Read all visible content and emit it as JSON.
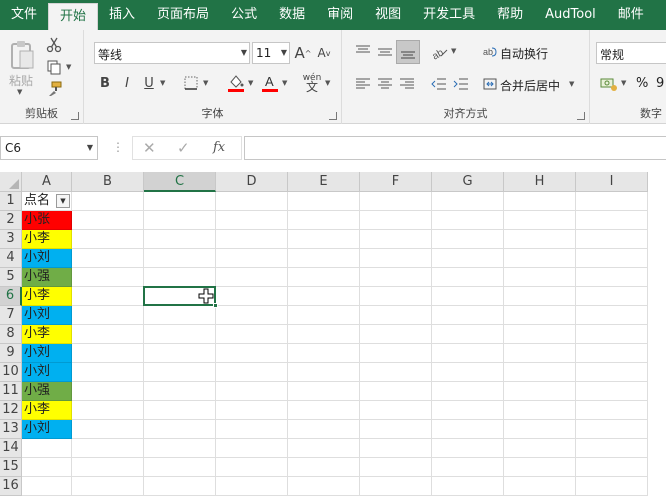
{
  "menu": {
    "tabs": [
      "文件",
      "开始",
      "插入",
      "页面布局",
      "公式",
      "数据",
      "审阅",
      "视图",
      "开发工具",
      "帮助",
      "AudTool",
      "邮件"
    ],
    "active_index": 1
  },
  "ribbon": {
    "clipboard": {
      "label": "剪贴板",
      "paste_label": "粘贴"
    },
    "font": {
      "label": "字体",
      "font_name": "等线",
      "font_size": "11",
      "bold": "B",
      "italic": "I",
      "underline": "U",
      "grow": "A",
      "shrink": "A",
      "phonetic": "wén"
    },
    "alignment": {
      "label": "对齐方式",
      "wrap_text": "自动换行",
      "merge_center": "合并后居中"
    },
    "number": {
      "label": "数字",
      "format": "常规",
      "percent": "%",
      "comma": "9"
    }
  },
  "formula_bar": {
    "name_box": "C6",
    "fx": "fx",
    "formula": ""
  },
  "sheet": {
    "columns": [
      "A",
      "B",
      "C",
      "D",
      "E",
      "F",
      "G",
      "H",
      "I"
    ],
    "rows": [
      "1",
      "2",
      "3",
      "4",
      "5",
      "6",
      "7",
      "8",
      "9",
      "10",
      "11",
      "12",
      "13",
      "14",
      "15",
      "16"
    ],
    "header_cell": "点名",
    "names": [
      "小张",
      "小李",
      "小刘",
      "小强",
      "小李",
      "小刘",
      "小李",
      "小刘",
      "小刘",
      "小强",
      "小李",
      "小刘"
    ],
    "name_colors": [
      "#ff0000",
      "#ffff00",
      "#00b0f0",
      "#70ad47",
      "#ffff00",
      "#00b0f0",
      "#ffff00",
      "#00b0f0",
      "#00b0f0",
      "#70ad47",
      "#ffff00",
      "#00b0f0"
    ],
    "active_cell": "C6"
  },
  "colors": {
    "excel_green": "#217346"
  }
}
